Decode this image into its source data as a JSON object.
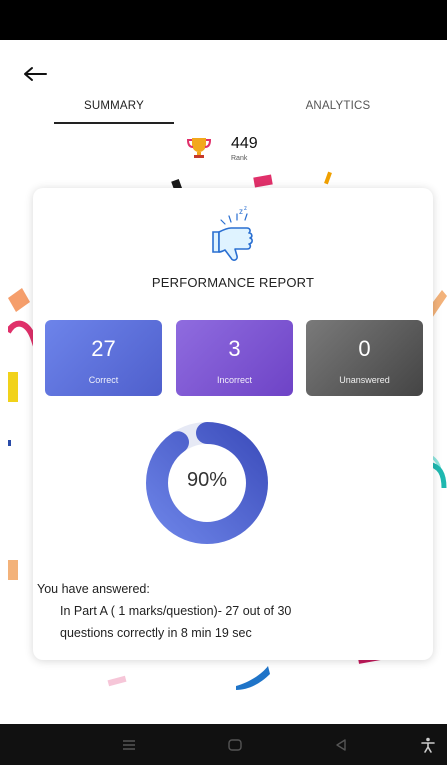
{
  "header": {
    "back_icon": "arrow-left-icon"
  },
  "tabs": [
    {
      "label": "SUMMARY",
      "active": true
    },
    {
      "label": "ANALYTICS",
      "active": false
    }
  ],
  "rank": {
    "value": "449",
    "label": "Rank",
    "icon": "trophy-icon"
  },
  "report": {
    "icon": "thumbs-down-icon",
    "title": "PERFORMANCE REPORT",
    "stats": [
      {
        "value": "27",
        "label": "Correct",
        "color": "#5b6fd9"
      },
      {
        "value": "3",
        "label": "Incorrect",
        "color": "#7f55d2"
      },
      {
        "value": "0",
        "label": "Unanswered",
        "color": "#5e5e5e"
      }
    ],
    "score": {
      "percent_text": "90%",
      "fraction": 0.9,
      "ring_color": "#4f5fcc"
    },
    "answered_intro": "You have answered:",
    "answered_line1": "In Part A ( 1 marks/question)- 27 out of 30",
    "answered_line2": "questions correctly in 8 min 19 sec"
  },
  "nav_bar": {
    "icons": [
      "menu-icon",
      "home-icon",
      "back-triangle-icon",
      "accessibility-icon"
    ]
  }
}
